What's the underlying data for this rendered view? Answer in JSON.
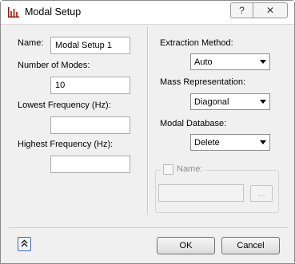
{
  "window": {
    "title": "Modal Setup",
    "help_glyph": "?",
    "close_glyph": "✕"
  },
  "left": {
    "name_label": "Name:",
    "name_value": "Modal Setup 1",
    "modes_label": "Number of Modes:",
    "modes_value": "10",
    "lowest_label": "Lowest Frequency (Hz):",
    "lowest_value": "",
    "highest_label": "Highest Frequency (Hz):",
    "highest_value": ""
  },
  "right": {
    "extraction_label": "Extraction Method:",
    "extraction_value": "Auto",
    "mass_label": "Mass Representation:",
    "mass_value": "Diagonal",
    "database_label": "Modal Database:",
    "database_value": "Delete",
    "group_label": "Name:",
    "group_field_value": "",
    "browse_label": "..."
  },
  "footer": {
    "ok_label": "OK",
    "cancel_label": "Cancel"
  },
  "colors": {
    "app_icon": "#c0392b",
    "expand_border": "#3a6ea5"
  }
}
